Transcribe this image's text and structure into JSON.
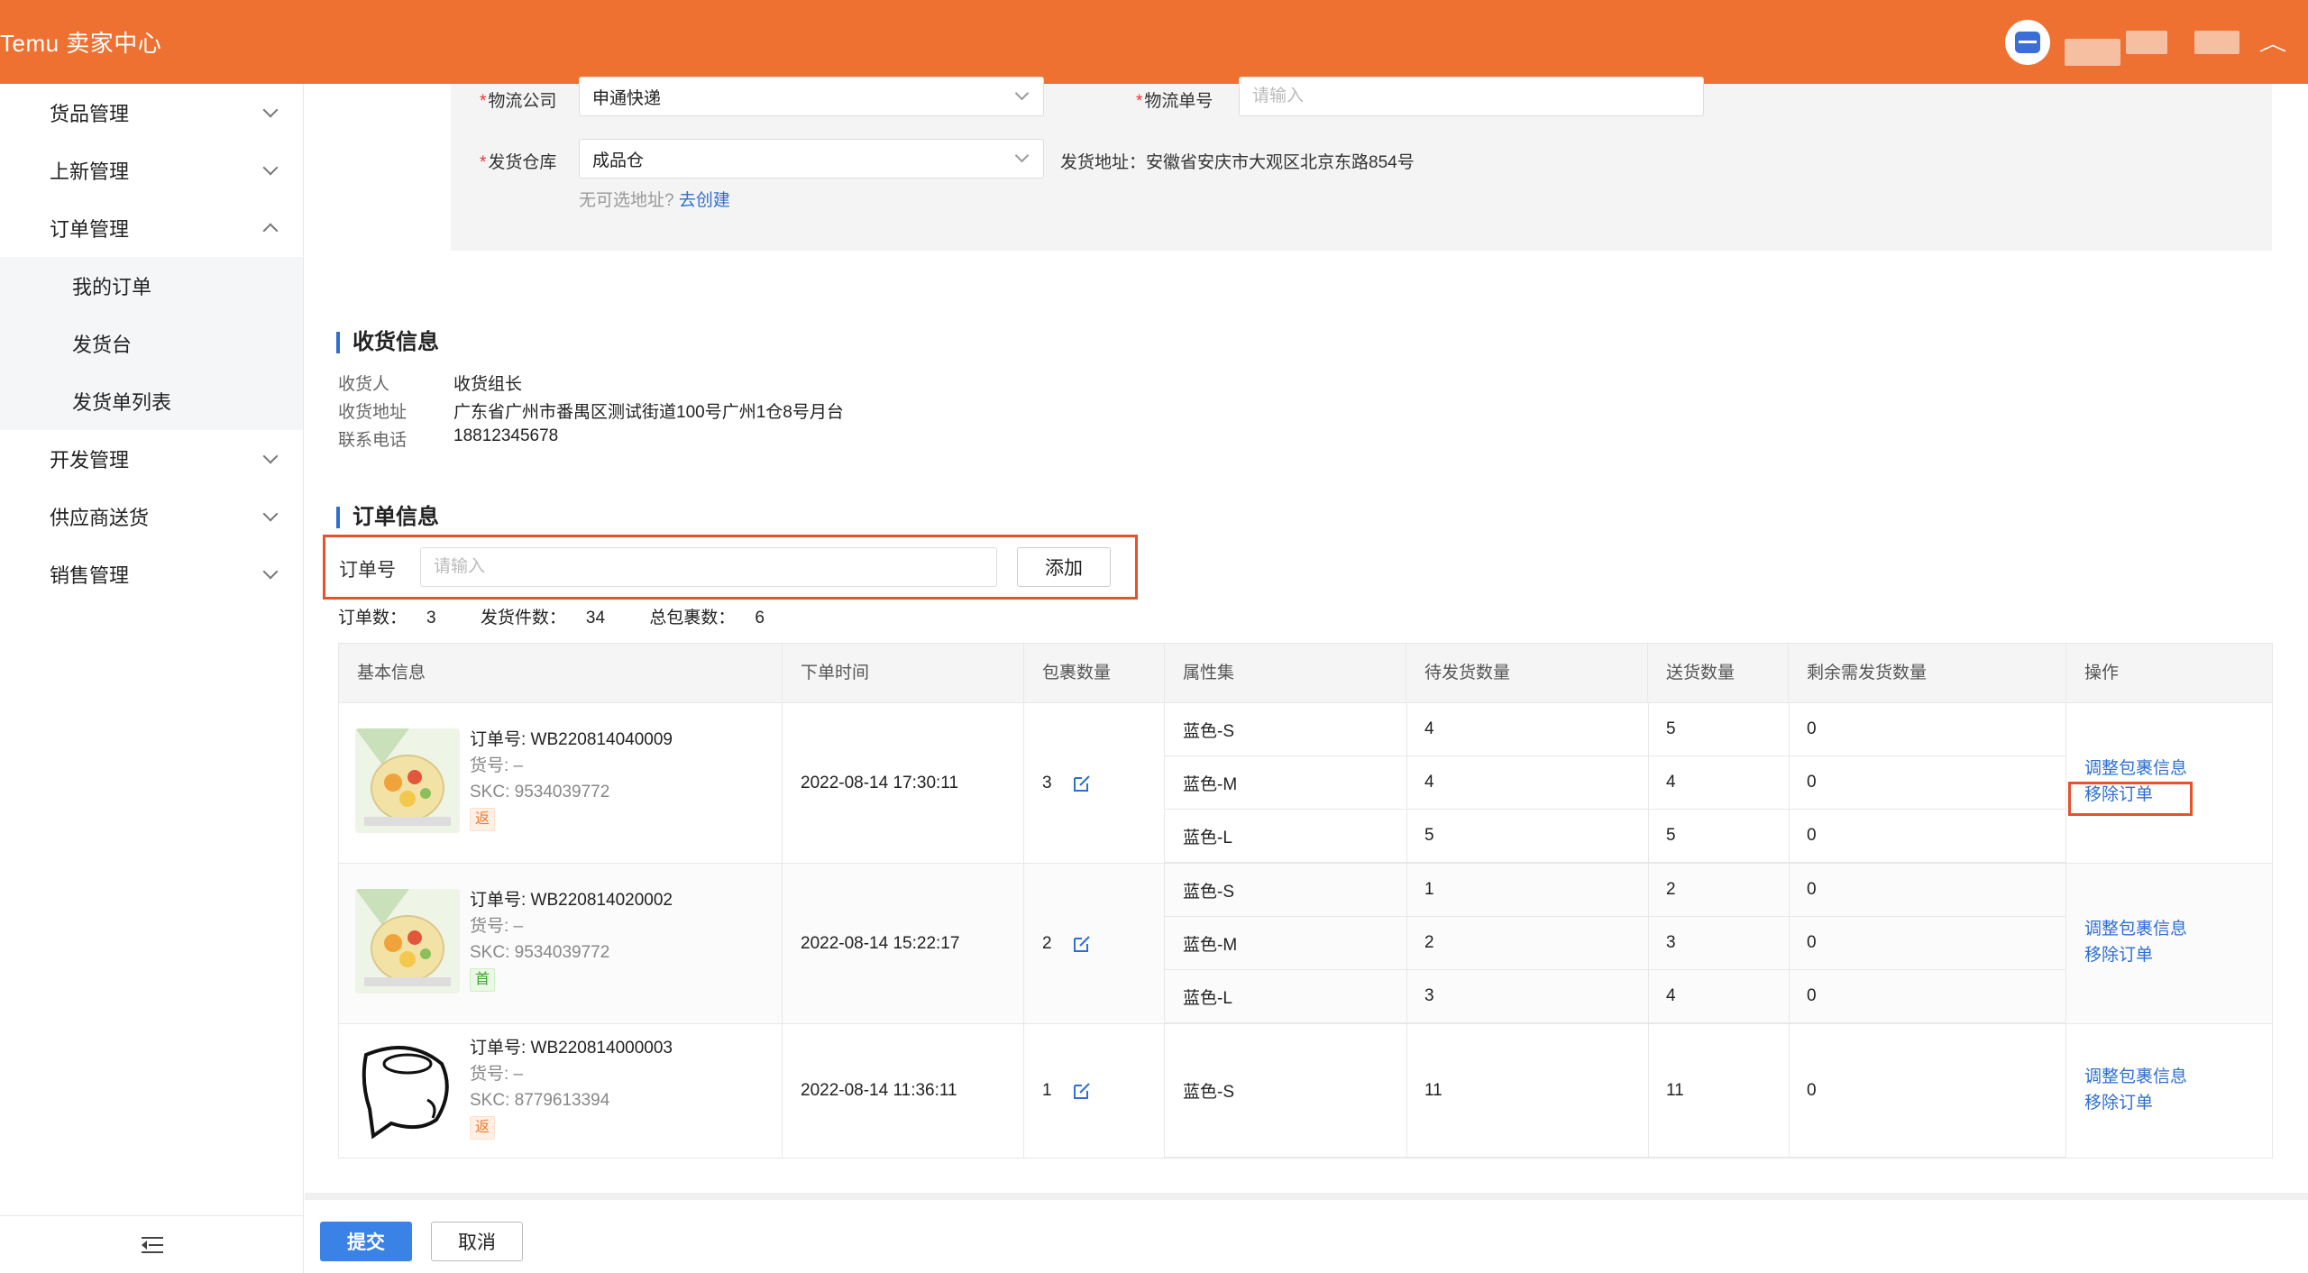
{
  "header": {
    "brand": "Temu 卖家中心"
  },
  "sidebar": {
    "items": [
      {
        "label": "货品管理"
      },
      {
        "label": "上新管理"
      },
      {
        "label": "订单管理"
      },
      {
        "label": "开发管理"
      },
      {
        "label": "供应商送货"
      },
      {
        "label": "销售管理"
      }
    ],
    "order_sub_items": [
      {
        "label": "我的订单"
      },
      {
        "label": "发货台"
      },
      {
        "label": "发货单列表"
      }
    ]
  },
  "shipping": {
    "logistics_company_label": "物流公司",
    "logistics_company_value": "申通快递",
    "tracking_no_label": "物流单号",
    "tracking_no_placeholder": "请输入",
    "warehouse_label": "发货仓库",
    "warehouse_value": "成品仓",
    "ship_address_label": "发货地址：",
    "ship_address_value": "安徽省安庆市大观区北京东路854号",
    "no_address_hint": "无可选地址?",
    "create_link": "去创建",
    "required_mark": "*"
  },
  "receiver": {
    "section_title": "收货信息",
    "name_label": "收货人",
    "name_value": "收货组长",
    "address_label": "收货地址",
    "address_value": "广东省广州市番禺区测试街道100号广州1仓8号月台",
    "phone_label": "联系电话",
    "phone_value": "18812345678"
  },
  "order_section": {
    "section_title": "订单信息",
    "order_no_label": "订单号",
    "order_no_placeholder": "请输入",
    "add_button": "添加",
    "stats": {
      "order_count_label": "订单数：",
      "order_count": "3",
      "items_label": "发货件数：",
      "items": "34",
      "packages_label": "总包裹数：",
      "packages": "6"
    }
  },
  "table": {
    "headers": [
      "基本信息",
      "下单时间",
      "包裹数量",
      "属性集",
      "待发货数量",
      "送货数量",
      "剩余需发货数量",
      "操作"
    ],
    "orders": [
      {
        "order_no": "订单号: WB220814040009",
        "item_no": "货号: –",
        "skc": "SKC: 9534039772",
        "tag": "返",
        "time": "2022-08-14 17:30:11",
        "packages": "3",
        "rows": [
          {
            "attr": "蓝色-S",
            "pending": "4",
            "delivered": "5",
            "remaining": "0"
          },
          {
            "attr": "蓝色-M",
            "pending": "4",
            "delivered": "4",
            "remaining": "0"
          },
          {
            "attr": "蓝色-L",
            "pending": "5",
            "delivered": "5",
            "remaining": "0"
          }
        ],
        "op_adjust": "调整包裹信息",
        "op_remove": "移除订单"
      },
      {
        "order_no": "订单号: WB220814020002",
        "item_no": "货号: –",
        "skc": "SKC: 9534039772",
        "tag": "首",
        "time": "2022-08-14 15:22:17",
        "packages": "2",
        "rows": [
          {
            "attr": "蓝色-S",
            "pending": "1",
            "delivered": "2",
            "remaining": "0"
          },
          {
            "attr": "蓝色-M",
            "pending": "2",
            "delivered": "3",
            "remaining": "0"
          },
          {
            "attr": "蓝色-L",
            "pending": "3",
            "delivered": "4",
            "remaining": "0"
          }
        ],
        "op_adjust": "调整包裹信息",
        "op_remove": "移除订单"
      },
      {
        "order_no": "订单号: WB220814000003",
        "item_no": "货号: –",
        "skc": "SKC: 8779613394",
        "tag": "返",
        "time": "2022-08-14 11:36:11",
        "packages": "1",
        "rows": [
          {
            "attr": "蓝色-S",
            "pending": "11",
            "delivered": "11",
            "remaining": "0"
          }
        ],
        "op_adjust": "调整包裹信息",
        "op_remove": "移除订单"
      }
    ]
  },
  "footer": {
    "submit": "提交",
    "cancel": "取消"
  },
  "colors": {
    "header": "#ee7131",
    "link": "#2f6fd0",
    "primary": "#3b82e6",
    "highlight": "#e5522b"
  }
}
